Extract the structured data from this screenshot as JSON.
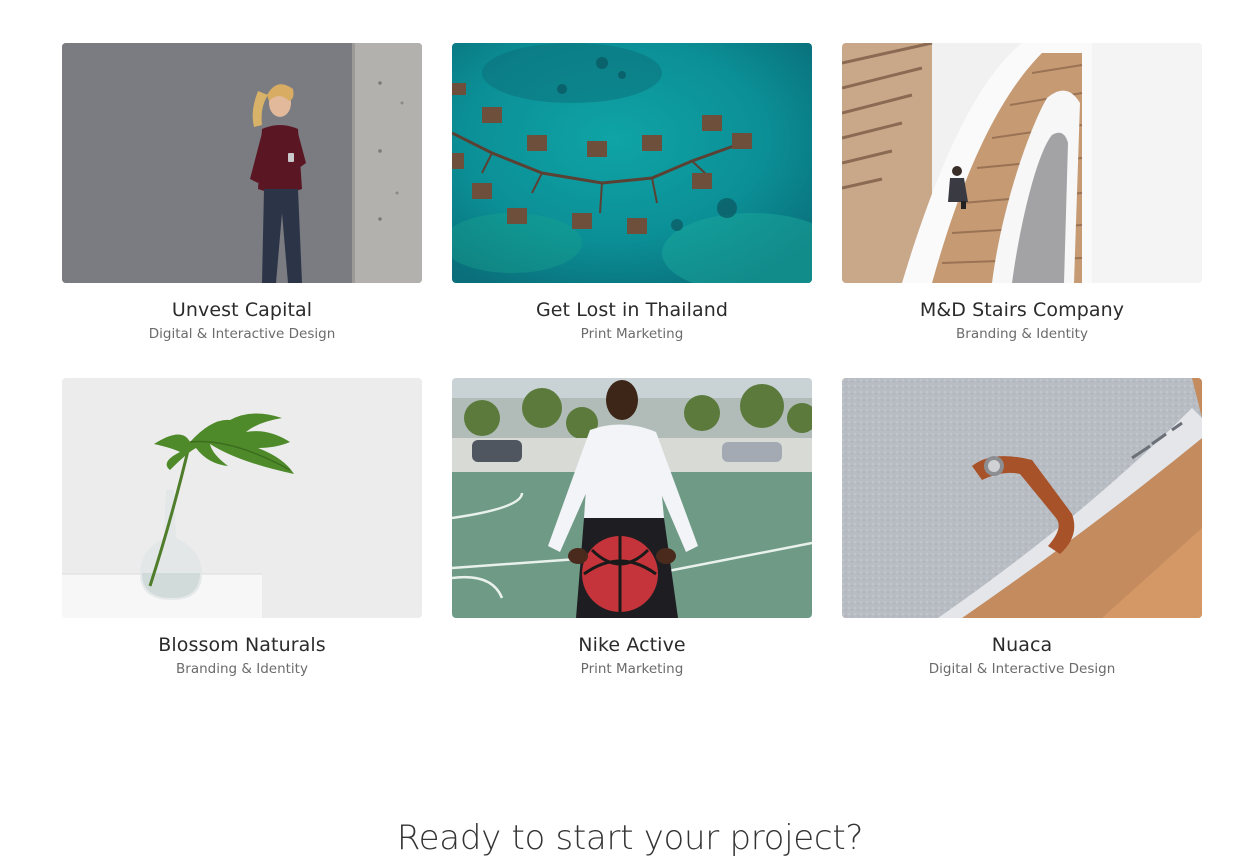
{
  "projects": [
    {
      "title": "Unvest Capital",
      "category": "Digital & Interactive Design",
      "image": "woman-leaning-on-wall"
    },
    {
      "title": "Get Lost in Thailand",
      "category": "Print Marketing",
      "image": "aerial-water-villas"
    },
    {
      "title": "M&D Stairs Company",
      "category": "Branding & Identity",
      "image": "spiral-staircase"
    },
    {
      "title": "Blossom Naturals",
      "category": "Branding & Identity",
      "image": "leaf-in-vase"
    },
    {
      "title": "Nike Active",
      "category": "Print Marketing",
      "image": "basketball-player"
    },
    {
      "title": "Nuaca",
      "category": "Digital & Interactive Design",
      "image": "felt-laptop-sleeve"
    }
  ],
  "cta": {
    "heading": "Ready to start your project?"
  }
}
